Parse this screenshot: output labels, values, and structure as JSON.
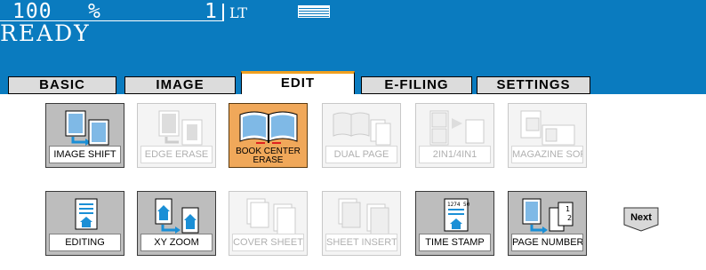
{
  "status": {
    "ratio": "100",
    "percent_sign": "%",
    "copies": "1",
    "tray": "LT",
    "message": "READY"
  },
  "tabs": [
    {
      "label": "BASIC",
      "active": false
    },
    {
      "label": "IMAGE",
      "active": false
    },
    {
      "label": "EDIT",
      "active": true
    },
    {
      "label": "E-FILING",
      "active": false
    },
    {
      "label": "SETTINGS",
      "active": false
    }
  ],
  "buttons": [
    {
      "label": "IMAGE SHIFT",
      "state": "enabled",
      "icon": "image-shift-icon"
    },
    {
      "label": "EDGE ERASE",
      "state": "disabled",
      "icon": "edge-erase-icon"
    },
    {
      "label": "BOOK CENTER ERASE",
      "state": "selected",
      "icon": "book-center-erase-icon"
    },
    {
      "label": "DUAL PAGE",
      "state": "disabled",
      "icon": "dual-page-icon"
    },
    {
      "label": "2IN1/4IN1",
      "state": "disabled",
      "icon": "2in1-4in1-icon"
    },
    {
      "label": "MAGAZINE SORT",
      "state": "disabled",
      "icon": "magazine-sort-icon"
    },
    {
      "label": "EDITING",
      "state": "enabled",
      "icon": "editing-icon"
    },
    {
      "label": "XY ZOOM",
      "state": "enabled",
      "icon": "xy-zoom-icon"
    },
    {
      "label": "COVER SHEET",
      "state": "disabled",
      "icon": "cover-sheet-icon"
    },
    {
      "label": "SHEET INSERTION",
      "state": "disabled",
      "icon": "sheet-insertion-icon"
    },
    {
      "label": "TIME STAMP",
      "state": "enabled",
      "icon": "time-stamp-icon"
    },
    {
      "label": "PAGE NUMBER",
      "state": "enabled",
      "icon": "page-number-icon"
    }
  ],
  "next_label": "Next",
  "time_stamp_icon_text": "1274 50"
}
